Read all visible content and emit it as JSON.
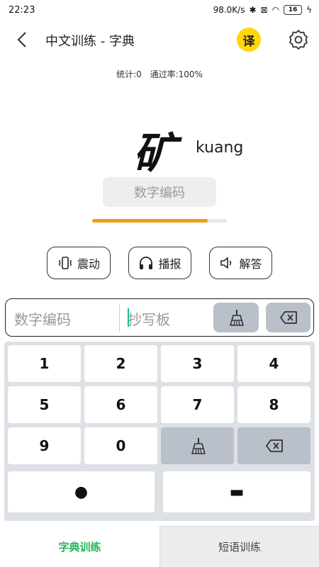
{
  "status_bar": {
    "time": "22:23",
    "speed": "98.0K/s",
    "battery": "16"
  },
  "header": {
    "title": "中文训练 - 字典",
    "translate_label": "译"
  },
  "stats": {
    "count": "统计:0",
    "pass_rate": "通过率:100%"
  },
  "character": {
    "hanzi": "矿",
    "pinyin": "kuang"
  },
  "code_display": {
    "placeholder": "数字编码"
  },
  "progress": {
    "fraction": 0.86,
    "color": "#f39c12"
  },
  "actions": [
    {
      "label": "震动",
      "icon": "vibrate-icon"
    },
    {
      "label": "播报",
      "icon": "headphones-icon"
    },
    {
      "label": "解答",
      "icon": "speaker-icon"
    }
  ],
  "input_bar": {
    "code_placeholder": "数字编码",
    "copy_placeholder": "抄写板"
  },
  "keypad": {
    "keys": [
      "1",
      "2",
      "3",
      "4",
      "5",
      "6",
      "7",
      "8",
      "9",
      "0"
    ],
    "dot": "●",
    "dash": "▬"
  },
  "tabs": [
    {
      "label": "字典训练",
      "active": true
    },
    {
      "label": "短语训练",
      "active": false
    }
  ],
  "colors": {
    "accent_green": "#1db954",
    "translate_yellow": "#ffd60a",
    "key_dark": "#b9c0c9"
  }
}
